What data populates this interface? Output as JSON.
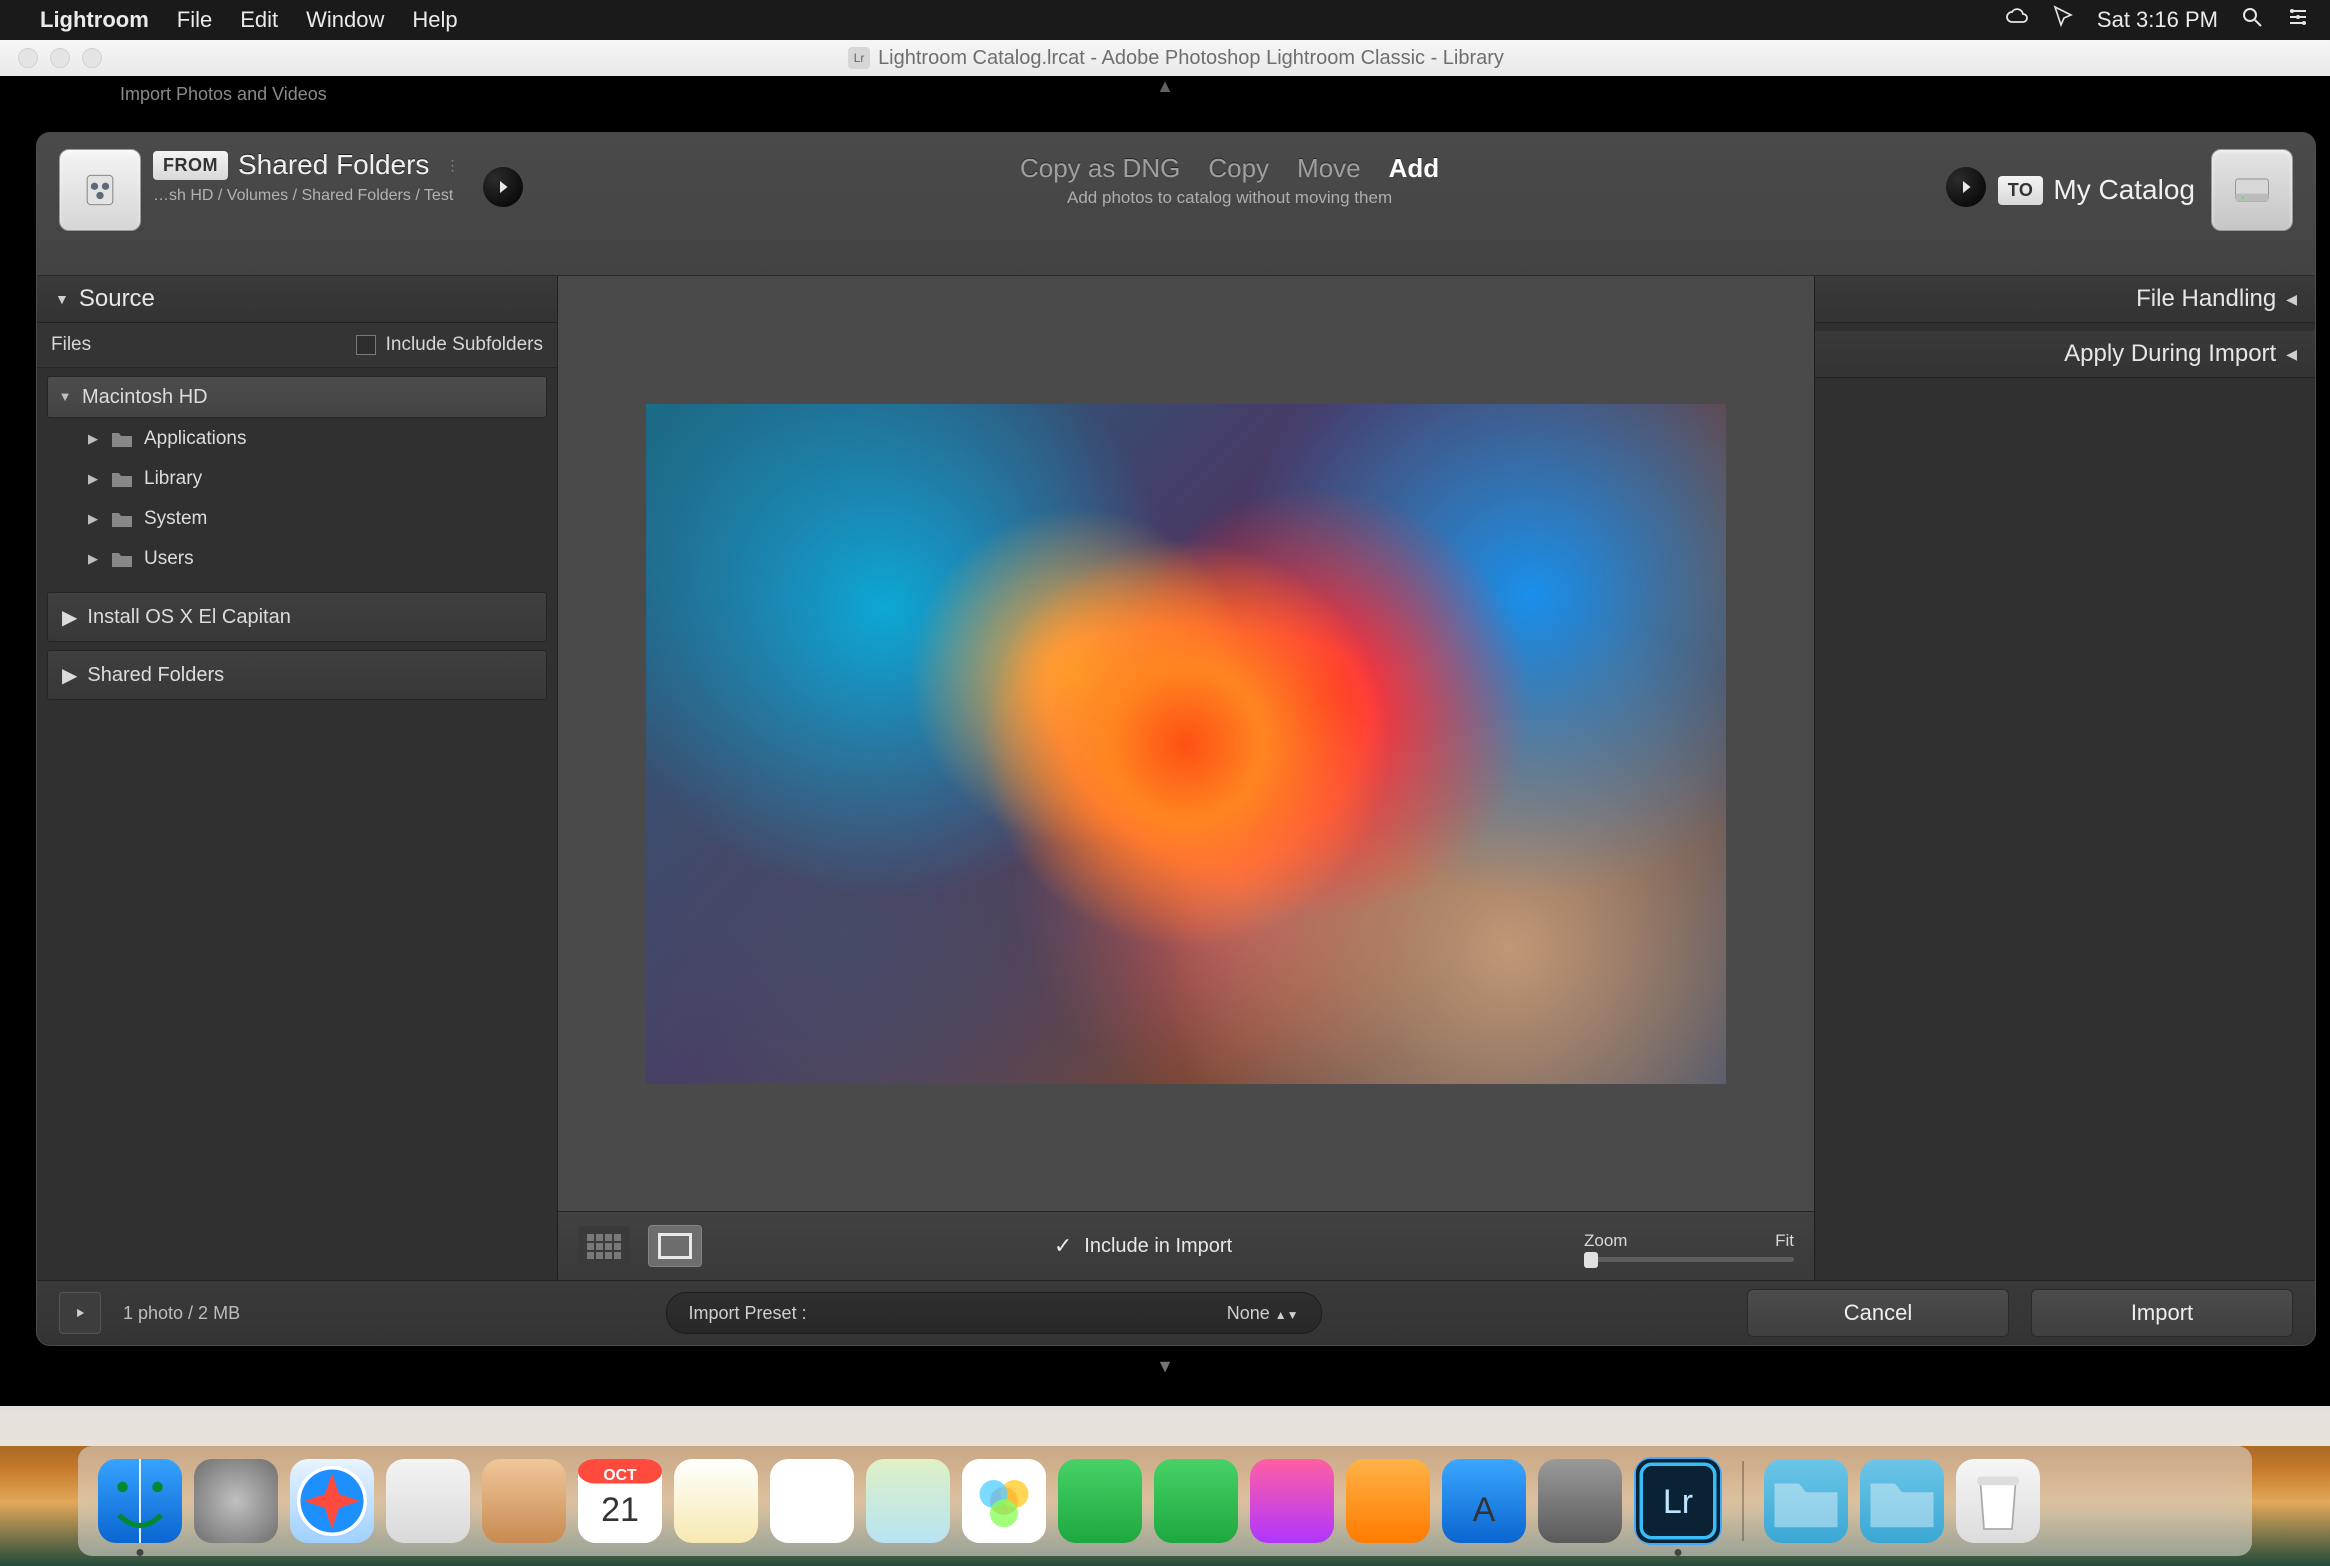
{
  "menubar": {
    "app": "Lightroom",
    "items": [
      "File",
      "Edit",
      "Window",
      "Help"
    ],
    "clock": "Sat 3:16 PM"
  },
  "window": {
    "title": "Lightroom Catalog.lrcat - Adobe Photoshop Lightroom Classic - Library",
    "back_label": "Import Photos and Videos"
  },
  "import": {
    "from_badge": "FROM",
    "from_title": "Shared Folders",
    "from_path": "…sh HD / Volumes / Shared Folders / Test",
    "ops": {
      "dng": "Copy as DNG",
      "copy": "Copy",
      "move": "Move",
      "add": "Add"
    },
    "op_sub": "Add photos to catalog without moving them",
    "to_badge": "TO",
    "to_title": "My Catalog"
  },
  "source": {
    "header": "Source",
    "files_label": "Files",
    "include_subfolders": "Include Subfolders",
    "disk": "Macintosh HD",
    "folders": [
      "Applications",
      "Library",
      "System",
      "Users"
    ],
    "extra": [
      "Install OS X El Capitan",
      "Shared Folders"
    ]
  },
  "right": {
    "file_handling": "File Handling",
    "apply_during_import": "Apply During Import"
  },
  "center": {
    "include_label": "Include in Import",
    "zoom_label": "Zoom",
    "fit_label": "Fit"
  },
  "bottom": {
    "status": "1 photo / 2 MB",
    "preset_label": "Import Preset :",
    "preset_value": "None",
    "cancel": "Cancel",
    "import": "Import"
  },
  "dock": {
    "apps": [
      {
        "name": "finder",
        "bg": "linear-gradient(#36a3ff,#0a65d0)",
        "label": "",
        "running": true
      },
      {
        "name": "launchpad",
        "bg": "radial-gradient(circle,#c0c0c0,#6e6e6e)",
        "label": "",
        "running": false
      },
      {
        "name": "safari",
        "bg": "linear-gradient(#e9f4ff,#9fd0ff)",
        "label": "",
        "running": false
      },
      {
        "name": "mail",
        "bg": "linear-gradient(#f4f4f4,#d9d9d9)",
        "label": "",
        "running": false
      },
      {
        "name": "contacts",
        "bg": "linear-gradient(#efc79a,#c98a52)",
        "label": "",
        "running": false
      },
      {
        "name": "calendar",
        "bg": "#fff",
        "label": "21",
        "running": false
      },
      {
        "name": "notes",
        "bg": "linear-gradient(#fff,#f7e9b0)",
        "label": "",
        "running": false
      },
      {
        "name": "reminders",
        "bg": "#fff",
        "label": "",
        "running": false
      },
      {
        "name": "maps",
        "bg": "linear-gradient(#dff1c6,#b7e3f2)",
        "label": "",
        "running": false
      },
      {
        "name": "photos",
        "bg": "#fff",
        "label": "",
        "running": false
      },
      {
        "name": "messages",
        "bg": "linear-gradient(#46d267,#1ea840)",
        "label": "",
        "running": false
      },
      {
        "name": "facetime",
        "bg": "linear-gradient(#46d267,#1ea840)",
        "label": "",
        "running": false
      },
      {
        "name": "itunes",
        "bg": "linear-gradient(#ff5fa2,#b036ff)",
        "label": "",
        "running": false
      },
      {
        "name": "ibooks",
        "bg": "linear-gradient(#ffb347,#ff7b00)",
        "label": "",
        "running": false
      },
      {
        "name": "appstore",
        "bg": "linear-gradient(#3aa7ff,#0a65d0)",
        "label": "A",
        "running": false
      },
      {
        "name": "preferences",
        "bg": "linear-gradient(#9a9a9a,#5a5a5a)",
        "label": "",
        "running": false
      },
      {
        "name": "lightroom",
        "bg": "#0a2233",
        "label": "Lr",
        "running": true
      }
    ],
    "right": [
      {
        "name": "apps-folder",
        "bg": "linear-gradient(#6cc6e8,#3aa7d4)"
      },
      {
        "name": "downloads-folder",
        "bg": "linear-gradient(#6cc6e8,#3aa7d4)"
      },
      {
        "name": "trash",
        "bg": "linear-gradient(#f6f6f6,#dcdcdc)"
      }
    ]
  }
}
